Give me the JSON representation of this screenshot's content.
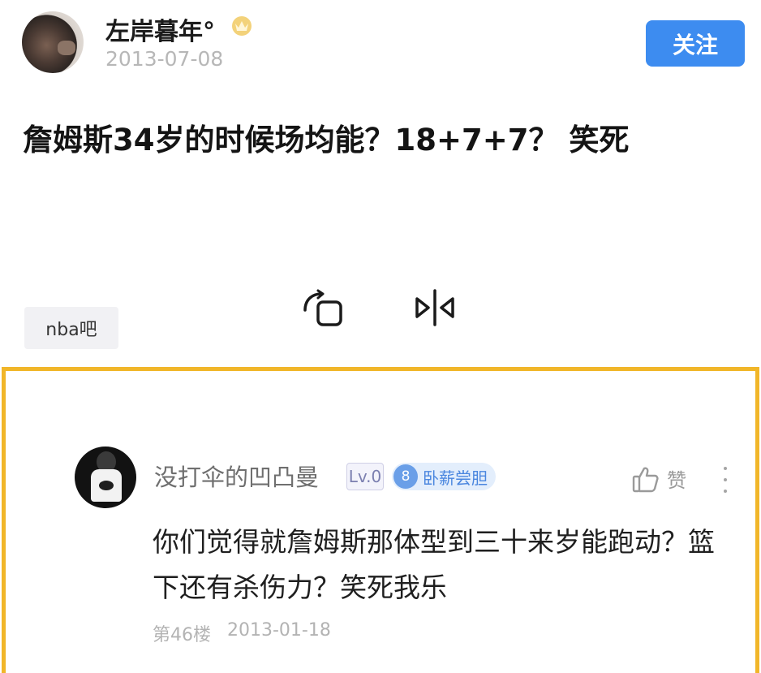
{
  "post": {
    "author": "左岸暮年°",
    "date": "2013-07-08",
    "follow_label": "关注",
    "title": "詹姆斯34岁的时候场均能？18+7+7？ 笑死",
    "tag": "nba吧"
  },
  "overlay": {
    "rotate_icon": "rotate-square-icon",
    "mirror_icon": "flip-horizontal-icon"
  },
  "reply": {
    "author": "没打伞的凹凸曼",
    "level": "Lv.0",
    "rank_number": "8",
    "rank_title": "卧薪尝胆",
    "like_label": "赞",
    "content": "你们觉得就詹姆斯那体型到三十来岁能跑动？篮下还有杀伤力？笑死我乐",
    "floor": "第46楼",
    "date": "2013-01-18"
  },
  "colors": {
    "accent_blue": "#3d8cf0",
    "highlight_frame": "#f1b629",
    "muted_text": "#b7b7b7"
  }
}
